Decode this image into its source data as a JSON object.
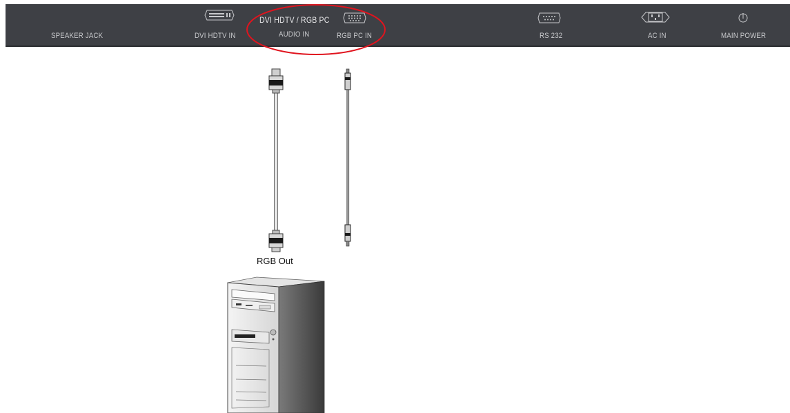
{
  "panel": {
    "speaker_jack": "SPEAKER JACK",
    "dvi_hdtv_in": "DVI HDTV IN",
    "audio_title": "DVI HDTV / RGB PC",
    "audio_in": "AUDIO IN",
    "rgb_pc_in": "RGB PC IN",
    "rs232": "RS 232",
    "ac_in": "AC IN",
    "main_power": "MAIN POWER",
    "bg_color": "#3e4045",
    "highlight_color": "#e0141e"
  },
  "diagram": {
    "rgb_out_label": "RGB Out"
  }
}
